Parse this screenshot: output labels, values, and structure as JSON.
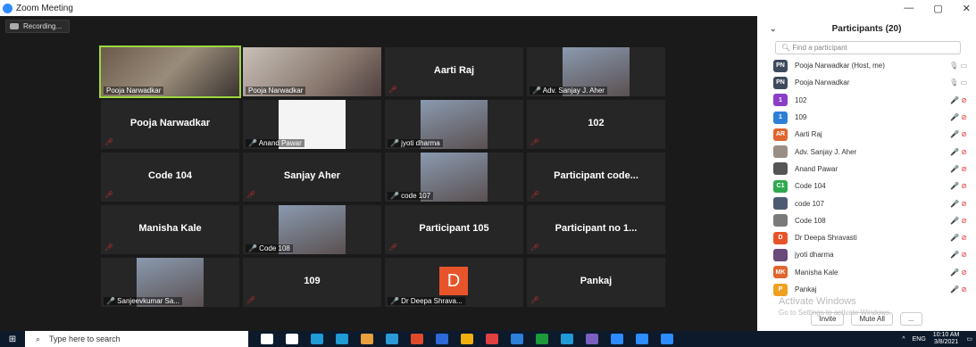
{
  "window": {
    "title": "Zoom Meeting",
    "controls": [
      "—",
      "▢",
      "✕"
    ]
  },
  "recording": {
    "label": "Recording..."
  },
  "tiles": [
    {
      "label": "Pooja Narwadkar",
      "type": "video",
      "active": true
    },
    {
      "label": "Pooja Narwadkar",
      "type": "video"
    },
    {
      "center": "Aarti Raj",
      "muted": true
    },
    {
      "label": "Adv. Sanjay J. Aher",
      "type": "photo",
      "muted": true
    },
    {
      "center": "Pooja Narwadkar",
      "muted": true
    },
    {
      "label": "Anand Pawar",
      "type": "logo",
      "muted": true
    },
    {
      "label": "jyoti dharma",
      "type": "photo",
      "muted": true
    },
    {
      "center": "102",
      "muted": true
    },
    {
      "center": "Code 104",
      "muted": true
    },
    {
      "center": "Sanjay Aher",
      "muted": true
    },
    {
      "label": "code 107",
      "type": "photo",
      "muted": true
    },
    {
      "center": "Participant code...",
      "muted": true
    },
    {
      "center": "Manisha Kale",
      "muted": true
    },
    {
      "label": "Code 108",
      "type": "photo",
      "muted": true
    },
    {
      "center": "Participant 105",
      "muted": true
    },
    {
      "center": "Participant no 1...",
      "muted": true
    },
    {
      "label": "Sanjeevkumar Sa...",
      "type": "photo",
      "muted": true
    },
    {
      "center": "109",
      "muted": true
    },
    {
      "label": "Dr Deepa Shrava...",
      "type": "letter",
      "letter": "D",
      "muted": true
    },
    {
      "center": "Pankaj",
      "muted": true
    }
  ],
  "panel": {
    "title": "Participants (20)",
    "search_placeholder": "Find a participant",
    "participants": [
      {
        "initials": "PN",
        "color": "#3c4a5c",
        "name": "Pooja Narwadkar (Host, me)",
        "status": "on"
      },
      {
        "initials": "PN",
        "color": "#3c4a5c",
        "name": "Pooja Narwadkar",
        "status": "on"
      },
      {
        "initials": "1",
        "color": "#8a3ec8",
        "name": "102",
        "status": "muted"
      },
      {
        "initials": "1",
        "color": "#2d7fd8",
        "name": "109",
        "status": "muted"
      },
      {
        "initials": "AR",
        "color": "#e0652e",
        "name": "Aarti Raj",
        "status": "muted"
      },
      {
        "initials": "",
        "color": "#9a8e84",
        "name": "Adv. Sanjay J. Aher",
        "status": "muted"
      },
      {
        "initials": "",
        "color": "#555555",
        "name": "Anand Pawar",
        "status": "muted"
      },
      {
        "initials": "C1",
        "color": "#2fa84f",
        "name": "Code 104",
        "status": "muted"
      },
      {
        "initials": "",
        "color": "#4d5b72",
        "name": "code 107",
        "status": "muted"
      },
      {
        "initials": "",
        "color": "#7a7a7a",
        "name": "Code 108",
        "status": "muted"
      },
      {
        "initials": "D",
        "color": "#e8542a",
        "name": "Dr Deepa Shravasti",
        "status": "muted"
      },
      {
        "initials": "",
        "color": "#6a4a7a",
        "name": "jyoti dharma",
        "status": "muted"
      },
      {
        "initials": "MK",
        "color": "#e0652e",
        "name": "Manisha Kale",
        "status": "muted"
      },
      {
        "initials": "P",
        "color": "#f0a020",
        "name": "Pankaj",
        "status": "muted"
      }
    ],
    "invite_label": "Invite",
    "mute_all_label": "Mute All",
    "more_label": "..."
  },
  "watermark": {
    "line1": "Activate Windows",
    "line2": "Go to Settings to activate Windows."
  },
  "taskbar": {
    "search_placeholder": "Type here to search",
    "lang": "ENG",
    "time": "10:10 AM",
    "date": "3/8/2021",
    "app_colors": [
      "#fff",
      "#fff",
      "#1f9bd6",
      "#1f9bd6",
      "#e8a03c",
      "#2d9ad8",
      "#e04a2a",
      "#2d6ad8",
      "#f0b010",
      "#e04040",
      "#2d7fd8",
      "#1c9a3a",
      "#1f9bd6",
      "#7b5fc0",
      "#2d8cff",
      "#2d8cff",
      "#2d8cff"
    ]
  }
}
